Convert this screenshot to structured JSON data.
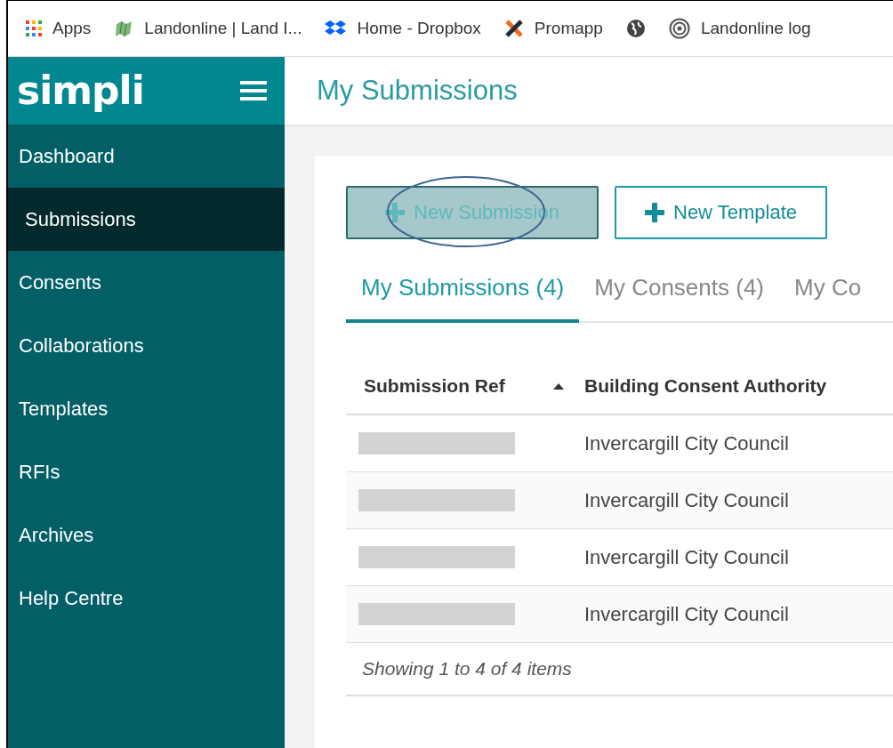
{
  "bookmarks": [
    {
      "kind": "apps",
      "label": "Apps"
    },
    {
      "kind": "map",
      "label": "Landonline | Land I..."
    },
    {
      "kind": "dropbox",
      "label": "Home - Dropbox"
    },
    {
      "kind": "cross",
      "label": "Promapp"
    },
    {
      "kind": "globe"
    },
    {
      "kind": "target",
      "label": "Landonline log"
    }
  ],
  "sidebar": {
    "logo": "simpli",
    "items": [
      {
        "label": "Dashboard",
        "selected": false
      },
      {
        "label": "Submissions",
        "selected": true
      },
      {
        "label": "Consents",
        "selected": false
      },
      {
        "label": "Collaborations",
        "selected": false
      },
      {
        "label": "Templates",
        "selected": false
      },
      {
        "label": "RFIs",
        "selected": false
      },
      {
        "label": "Archives",
        "selected": false
      },
      {
        "label": "Help Centre",
        "selected": false
      }
    ]
  },
  "page_title": "My Submissions",
  "buttons": [
    {
      "label": "New Submission",
      "disabled": true,
      "annotated": true
    },
    {
      "label": "New Template",
      "disabled": false,
      "annotated": false
    }
  ],
  "tabs": [
    {
      "label": "My Submissions (4)",
      "selected": true
    },
    {
      "label": "My Consents (4)",
      "selected": false
    },
    {
      "label": "My Co",
      "selected": false
    }
  ],
  "table": {
    "columns": [
      {
        "label": "Submission Ref",
        "sorted": true
      },
      {
        "label": "Building Consent Authority",
        "sorted": false
      }
    ],
    "rows": [
      {
        "ref_redacted": true,
        "authority": "Invercargill City Council"
      },
      {
        "ref_redacted": true,
        "authority": "Invercargill City Council"
      },
      {
        "ref_redacted": true,
        "authority": "Invercargill City Council"
      },
      {
        "ref_redacted": true,
        "authority": "Invercargill City Council"
      }
    ],
    "footer": "Showing 1 to 4 of 4 items"
  }
}
